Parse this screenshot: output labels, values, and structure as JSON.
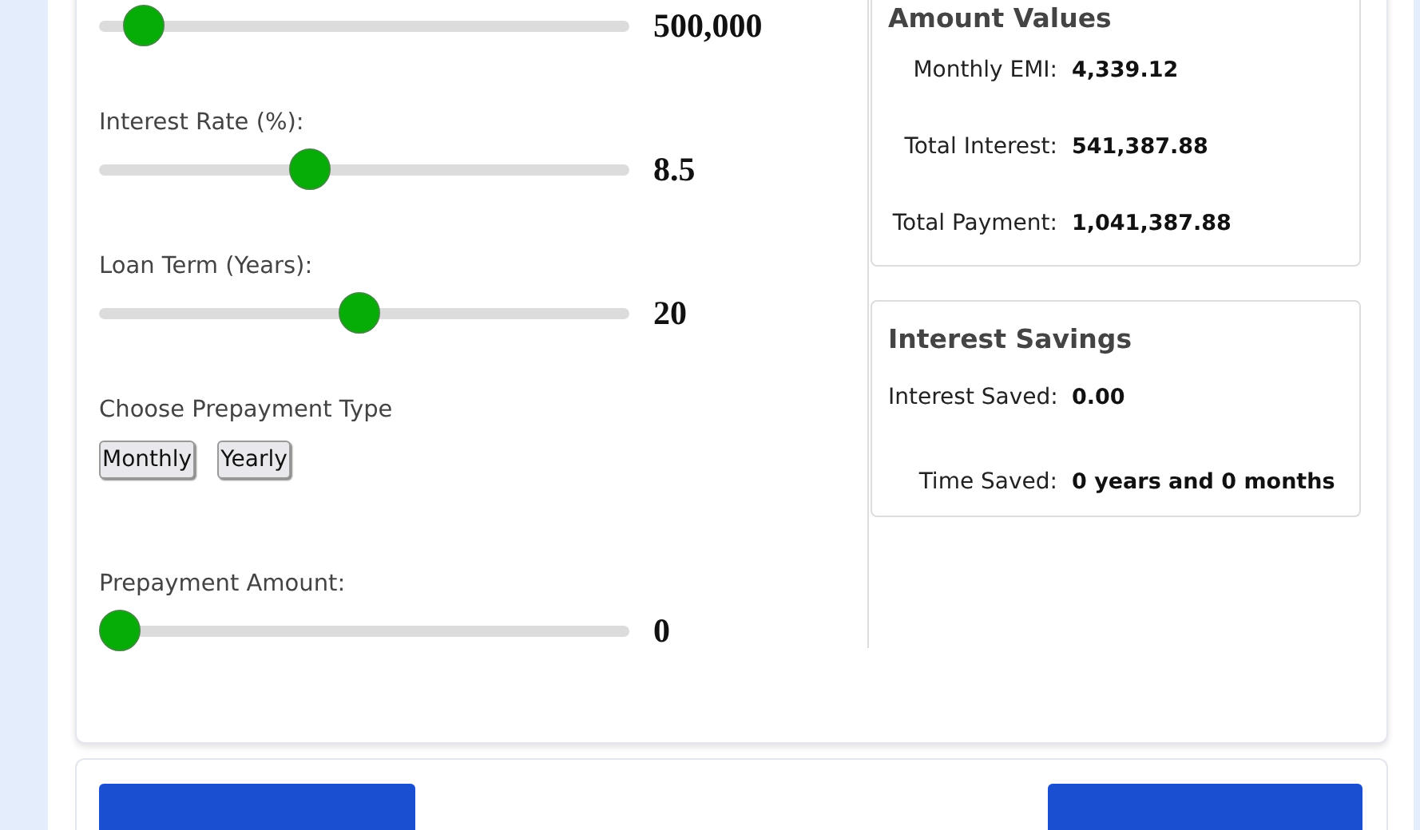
{
  "calculator": {
    "sliders": [
      {
        "value": "500,000",
        "level": 0.05
      },
      {
        "label": "Interest Rate (%):",
        "value": "8.5",
        "level": 0.39
      },
      {
        "label": "Loan Term (Years):",
        "value": "20",
        "level": 0.49
      }
    ],
    "prepayment_type": {
      "label": "Choose Prepayment Type",
      "options": [
        "Monthly",
        "Yearly"
      ]
    },
    "prepayment_slider": {
      "label": "Prepayment Amount:",
      "value": "0",
      "level": 0
    },
    "amount_values": {
      "title": "Amount Values",
      "rows": [
        {
          "label": "Monthly EMI:",
          "value": "4,339.12"
        },
        {
          "label": "Total Interest:",
          "value": "541,387.88"
        },
        {
          "label": "Total Payment:",
          "value": "1,041,387.88"
        }
      ]
    },
    "interest_savings": {
      "title": "Interest Savings",
      "rows": [
        {
          "label": "Interest Saved:",
          "value": "0.00"
        },
        {
          "label": "Time Saved:",
          "value": "0 years and 0 months"
        }
      ]
    }
  }
}
